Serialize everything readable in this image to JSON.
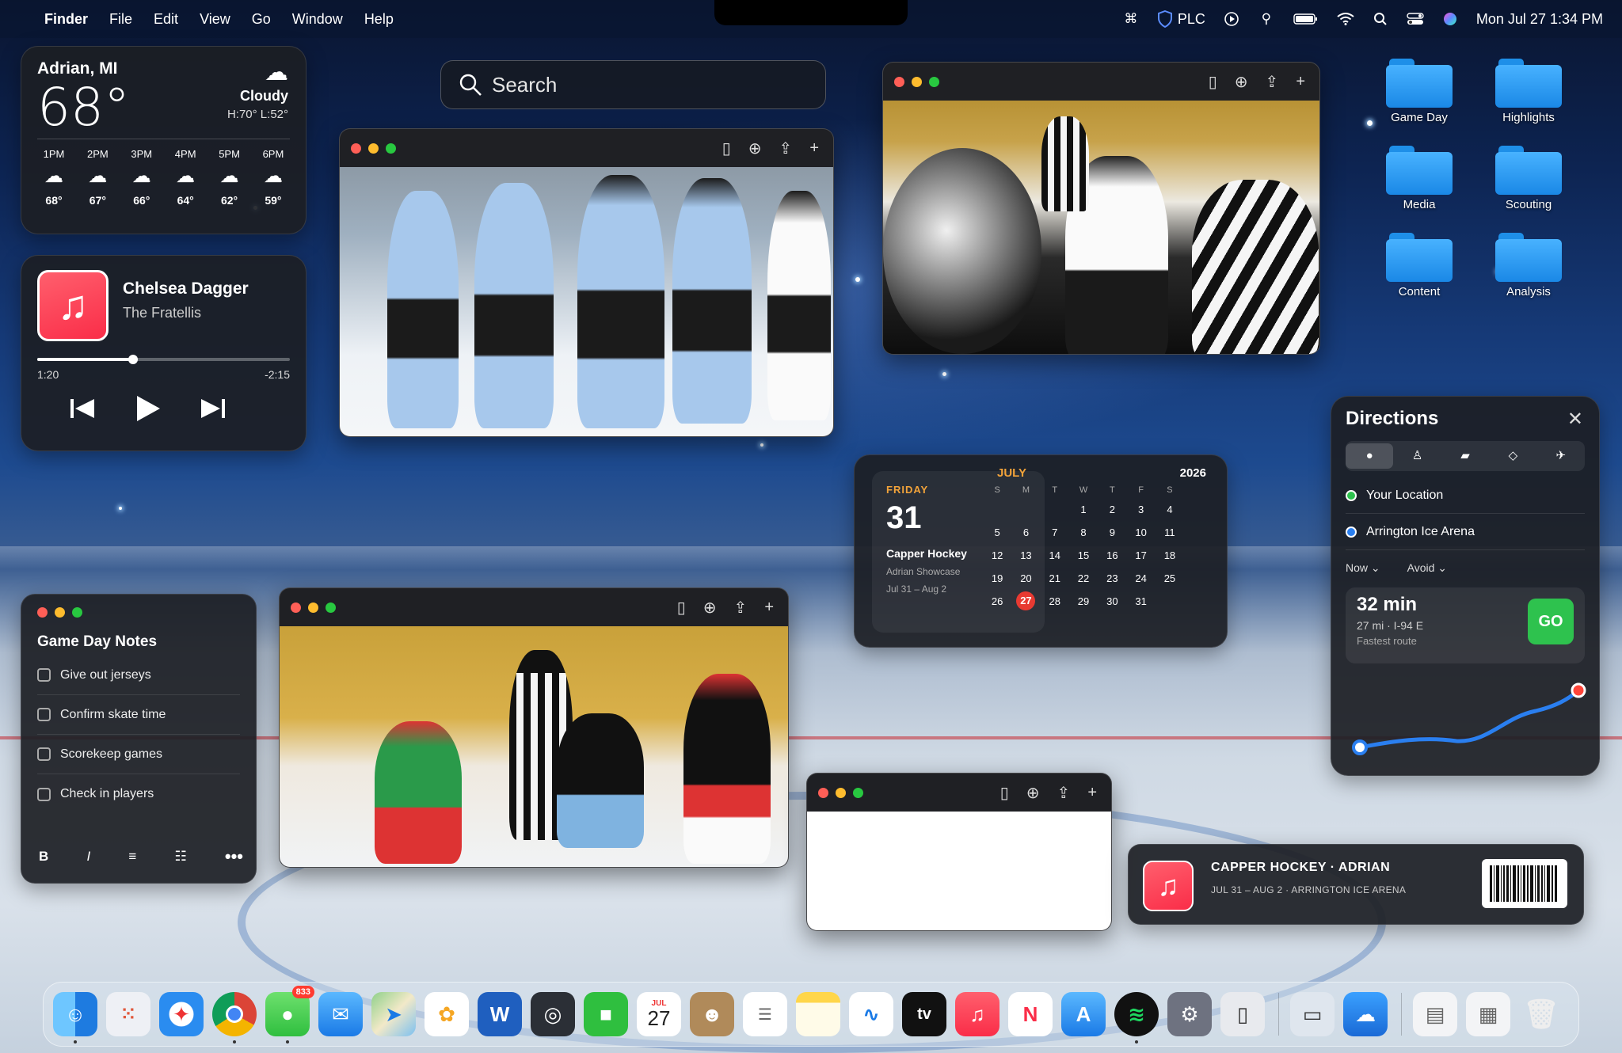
{
  "menubar": {
    "app_name": "Finder",
    "menus": [
      "File",
      "Edit",
      "View",
      "Go",
      "Window",
      "Help"
    ],
    "status_label": "PLC",
    "datetime": "Mon Jul 27  1:34 PM"
  },
  "search": {
    "placeholder": "Search"
  },
  "weather": {
    "city": "Adrian, MI",
    "temp": "68°",
    "condition": "Cloudy",
    "high_low": "H:70° L:52°",
    "hours": [
      {
        "time": "1PM",
        "temp": "68°"
      },
      {
        "time": "2PM",
        "temp": "67°"
      },
      {
        "time": "3PM",
        "temp": "66°"
      },
      {
        "time": "4PM",
        "temp": "64°"
      },
      {
        "time": "5PM",
        "temp": "62°"
      },
      {
        "time": "6PM",
        "temp": "59°"
      }
    ]
  },
  "music": {
    "song": "Chelsea Dagger",
    "artist": "The Fratellis",
    "elapsed": "1:20",
    "remaining": "-2:15",
    "progress": 0.38
  },
  "notes": {
    "title": "Game Day Notes",
    "items": [
      "Give out jerseys",
      "Confirm skate time",
      "Scorekeep games",
      "Check in players"
    ],
    "tools": [
      "B",
      "I"
    ]
  },
  "calendar": {
    "dow": "FRIDAY",
    "day": "31",
    "event": "Capper Hockey",
    "event_sub": "Adrian Showcase",
    "event_dates": "Jul 31 – Aug 2",
    "month": "JULY",
    "year": "2026",
    "headers": [
      "S",
      "M",
      "T",
      "W",
      "T",
      "F",
      "S"
    ],
    "today": "27"
  },
  "directions": {
    "title": "Directions",
    "from": "Your Location",
    "to": "Arrington Ice Arena",
    "when": "Now ⌄",
    "avoid": "Avoid ⌄",
    "duration": "32 min",
    "distance": "27 mi · I-94 E",
    "note": "Fastest route",
    "go": "GO"
  },
  "ticket": {
    "title": "CAPPER HOCKEY · ADRIAN",
    "subtitle": "JUL 31 – AUG 2 · ARRINGTON ICE ARENA"
  },
  "folders": [
    "Game Day",
    "Highlights",
    "Media",
    "Scouting",
    "Content",
    "Analysis"
  ],
  "dock": {
    "messages_badge": "833",
    "calendar_month": "JUL",
    "calendar_day": "27",
    "tv_label": "tv"
  },
  "colors": {
    "accent": "#e83a32",
    "calendar_orange": "#f2a33a",
    "go_green": "#2ec24e",
    "folder_blue": "#1a88e6"
  }
}
